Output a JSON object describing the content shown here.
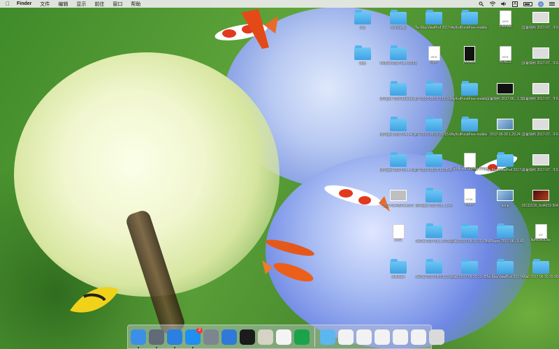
{
  "menubar": {
    "apple_icon": "apple-icon",
    "app_name": "Finder",
    "items": [
      "文件",
      "编辑",
      "显示",
      "前往",
      "窗口",
      "帮助"
    ],
    "status_icons": [
      "spotlight-icon",
      "wifi-icon",
      "volume-icon",
      "input-method-icon",
      "battery-icon",
      "user-avatar-icon",
      "notification-list-icon"
    ],
    "input_method_label": "A"
  },
  "desktop_icons": [
    {
      "label": "okc",
      "kind": "folder"
    },
    {
      "label": "fontconfig",
      "kind": "folder"
    },
    {
      "label": "TecMacViewPref 2017-05...4-09-22",
      "kind": "folder"
    },
    {
      "label": "myKoiPondFree-mobile 2...0-55-41",
      "kind": "folder"
    },
    {
      "label": "Unknow",
      "kind": "doc",
      "badge": "WEB"
    },
    {
      "label": "屏幕快照 2017-07...午9.15.27",
      "kind": "screenshot"
    },
    {
      "label": "tusp",
      "kind": "folder"
    },
    {
      "label": "TecDiet 2017-04...09-33-16",
      "kind": "folder"
    },
    {
      "label": "cgm",
      "kind": "doc",
      "badge": "WEB"
    },
    {
      "label": "pondkoi",
      "kind": "image"
    },
    {
      "label": "HTMLS",
      "kind": "doc",
      "badge": "WEB"
    },
    {
      "label": "屏幕快照 2017-07...午9.14.17",
      "kind": "screenshot"
    },
    {
      "label": "MPlayer OSX Extende...0-57-35",
      "kind": "folder"
    },
    {
      "label": "PP 2017-05-07 21-53-32",
      "kind": "folder"
    },
    {
      "label": "myKoiPondFree-mobile 2...9-12-24",
      "kind": "folder"
    },
    {
      "label": "屏幕快照 2017-06...1.33.07",
      "kind": "screenshot-dark"
    },
    {
      "label": "屏幕快照 2017-07...午9.14.15",
      "kind": "screenshot"
    },
    {
      "label": "IMPlayer 2017-04...4-32-14",
      "kind": "folder"
    },
    {
      "label": "PP 2017-05-07 20-15-03",
      "kind": "folder"
    },
    {
      "label": "myKoiPondFree-mobile 2...0-15-09",
      "kind": "folder"
    },
    {
      "label": "2017-06-28 1.29.24",
      "kind": "screenshot-img"
    },
    {
      "label": "屏幕快照 2017-07...午9.14.13",
      "kind": "screenshot"
    },
    {
      "label": "IMPlayer 2017-04...4-32-24",
      "kind": "folder"
    },
    {
      "label": "PP 2017-05-07 19-05-49",
      "kind": "folder"
    },
    {
      "label": "CertificateSigning Request...Request",
      "kind": "doc",
      "badge": ""
    },
    {
      "label": "TecMacViewPref 2017-06...11-41-22",
      "kind": "folder"
    },
    {
      "label": "屏幕快照 2017-07...午9.14.08",
      "kind": "screenshot"
    },
    {
      "label": "2017-04-0574.4.5 0",
      "kind": "screenshot-gray"
    },
    {
      "label": "IMPlayer 2017-06...1-47-54",
      "kind": "folder"
    },
    {
      "label": "index",
      "kind": "doc",
      "badge": "HTML"
    },
    {
      "label": "temp",
      "kind": "screenshot-img"
    },
    {
      "label": "92111516_fcd4219 5047e4...5c_t.mp4",
      "kind": "screenshot-red"
    },
    {
      "label": "dec1",
      "kind": "doc",
      "badge": ""
    },
    {
      "label": "TecVic 2017-06...0-33-33",
      "kind": "folder"
    },
    {
      "label": "iWall 2017-05-30 10-15-05",
      "kind": "folder"
    },
    {
      "label": "IMPlayer 2017-06...9-43-43",
      "kind": "folder"
    },
    {
      "label": "lightclock.zip",
      "kind": "doc",
      "badge": "ZIP"
    },
    {
      "label": "software",
      "kind": "folder"
    },
    {
      "label": "TecVic 2017-05-01 19-43-28",
      "kind": "folder"
    },
    {
      "label": "iWall 2017-05-30 10-05-06",
      "kind": "folder"
    },
    {
      "label": "TecMacViewPref 2017-06...11-11-26",
      "kind": "folder"
    },
    {
      "label": "iWall 2017-06-30 15-58-03",
      "kind": "folder"
    }
  ],
  "dock": {
    "apps": [
      {
        "name": "finder-icon",
        "color": "#3b8fe6"
      },
      {
        "name": "launchpad-icon",
        "color": "#606a78"
      },
      {
        "name": "safari-icon",
        "color": "#2a7fe0"
      },
      {
        "name": "app-store-icon",
        "color": "#1f8ff0",
        "badge": "2"
      },
      {
        "name": "system-preferences-icon",
        "color": "#7d8590"
      },
      {
        "name": "xcode-icon",
        "color": "#2f7ad8"
      },
      {
        "name": "terminal-icon",
        "color": "#1b1b1b"
      },
      {
        "name": "preview-icon",
        "color": "#d6d2c4"
      },
      {
        "name": "paint-icon",
        "color": "#f4f4f4"
      },
      {
        "name": "koi-app-icon",
        "color": "#1aa34a"
      }
    ],
    "stacks": [
      {
        "name": "downloads-folder-icon",
        "color": "#5cb7ef"
      },
      {
        "name": "recent-doc-1-icon",
        "color": "#f2f2f2"
      },
      {
        "name": "recent-doc-2-icon",
        "color": "#f2f2f2"
      },
      {
        "name": "recent-doc-3-icon",
        "color": "#f2f2f2"
      },
      {
        "name": "recent-doc-4-icon",
        "color": "#f2f2f2"
      },
      {
        "name": "recent-doc-5-icon",
        "color": "#f2f2f2"
      },
      {
        "name": "trash-icon",
        "color": "#dadada"
      }
    ]
  }
}
